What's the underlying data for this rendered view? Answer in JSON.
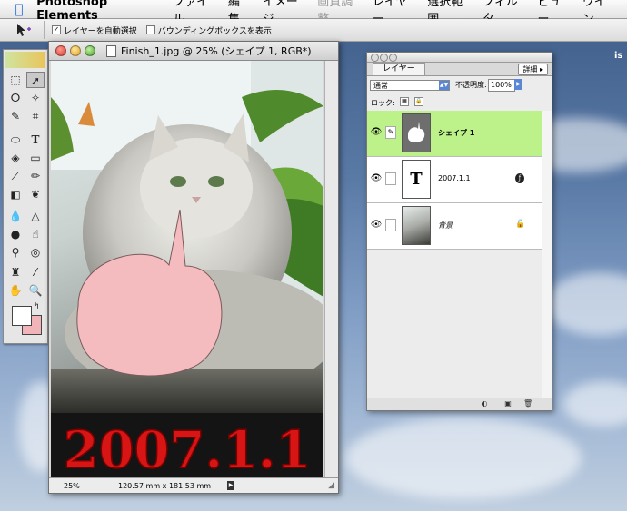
{
  "menubar": {
    "app_name": "Photoshop Elements",
    "menus": [
      "ファイル",
      "編集",
      "イメージ",
      "画質調整",
      "レイヤー",
      "選択範囲",
      "フィルタ",
      "ビュー",
      "ウイン"
    ],
    "disabled_menus": [
      "画質調整"
    ]
  },
  "options_bar": {
    "auto_select_label": "レイヤーを自動選択",
    "auto_select_checked": true,
    "bounding_box_label": "バウンディングボックスを表示",
    "bounding_box_checked": false
  },
  "document": {
    "title": "Finish_1.jpg @ 25% (シェイプ 1, RGB*)",
    "zoom": "25%",
    "dimensions": "120.57 mm x 181.53 mm",
    "canvas_text": "2007.1.1",
    "speech_bubble_color": "#f5bcc0"
  },
  "layers_palette": {
    "tab_label": "レイヤー",
    "more_label": "詳細",
    "blend_mode": "通常",
    "opacity_label": "不透明度:",
    "opacity_value": "100%",
    "lock_label": "ロック:",
    "layers": [
      {
        "name": "シェイプ 1",
        "type": "shape",
        "active": true,
        "visible": true
      },
      {
        "name": "2007.1.1",
        "type": "text",
        "active": false,
        "visible": true
      },
      {
        "name": "背景",
        "type": "background",
        "active": false,
        "visible": true,
        "locked": true
      }
    ]
  },
  "desktop": {
    "corner_text": "is"
  },
  "colors": {
    "active_layer": "#bdf28a",
    "foreground": "#ffffff",
    "background": "#f1b4b9",
    "accent_blue": "#5a86d6"
  }
}
